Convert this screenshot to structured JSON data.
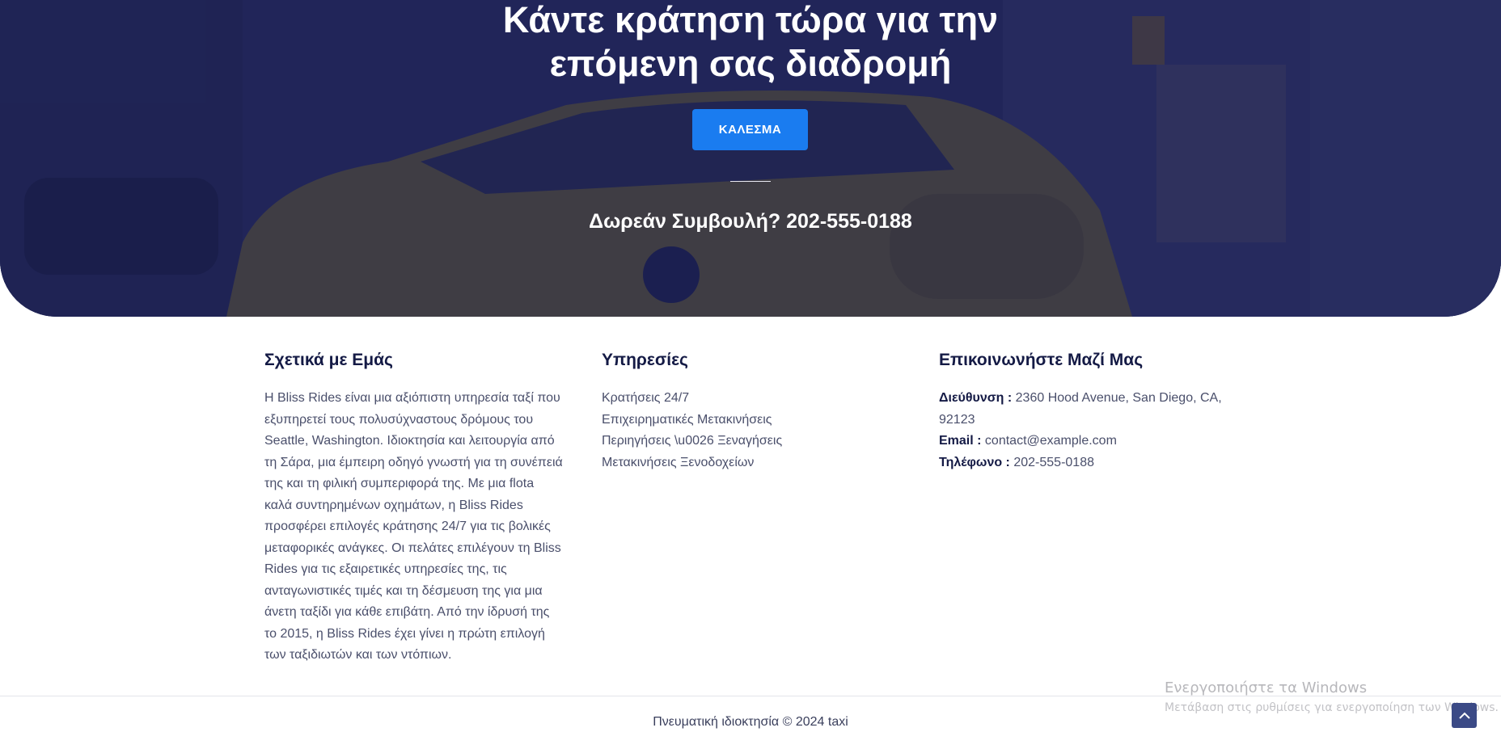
{
  "hero": {
    "title": "Κάντε κράτηση τώρα για την\nεπόμενη σας διαδρομή",
    "call_button": "ΚΑΛΕΣΜΑ",
    "consultation": "Δωρεάν Συμβουλή? 202-555-0188"
  },
  "about": {
    "heading": "Σχετικά με Εμάς",
    "text": "Η Bliss Rides είναι μια αξιόπιστη υπηρεσία ταξί που εξυπηρετεί τους πολυσύχναστους δρόμους του Seattle, Washington. Ιδιοκτησία και λειτουργία από τη Σάρα, μια έμπειρη οδηγό γνωστή για τη συνέπειά της και τη φιλική συμπεριφορά της. Με μια flota καλά συντηρημένων οχημάτων, η Bliss Rides προσφέρει επιλογές κράτησης 24/7 για τις βολικές μεταφορικές ανάγκες. Οι πελάτες επιλέγουν τη Bliss Rides για τις εξαιρετικές υπηρεσίες της, τις ανταγωνιστικές τιμές και τη δέσμευση της για μια άνετη ταξίδι για κάθε επιβάτη. Από την ίδρυσή της το 2015, η Bliss Rides έχει γίνει η πρώτη επιλογή των ταξιδιωτών και των ντόπιων."
  },
  "services": {
    "heading": "Υπηρεσίες",
    "items": [
      "Κρατήσεις 24/7",
      "Επιχειρηματικές Μετακινήσεις",
      "Περιηγήσεις \\u0026 Ξεναγήσεις",
      "Μετακινήσεις Ξενοδοχείων"
    ]
  },
  "contact": {
    "heading": "Επικοινωνήστε Μαζί Μας",
    "address_label": "Διεύθυνση :",
    "address": "2360 Hood Avenue, San Diego, CA, 92123",
    "email_label": "Email :",
    "email": "contact@example.com",
    "phone_label": "Τηλέφωνο :",
    "phone": "202-555-0188"
  },
  "footer": {
    "copyright": "Πνευματική ιδιοκτησία © 2024 taxi"
  },
  "windows_watermark": {
    "title": "Ενεργοποιήστε τα Windows",
    "subtitle": "Μετάβαση στις ρυθμίσεις για ενεργοποίηση των Windows."
  },
  "icons": {
    "back_to_top": "chevron-up-icon"
  },
  "colors": {
    "accent": "#1a7cf0",
    "heading": "#141a45",
    "hero_overlay": "#1e2458"
  }
}
